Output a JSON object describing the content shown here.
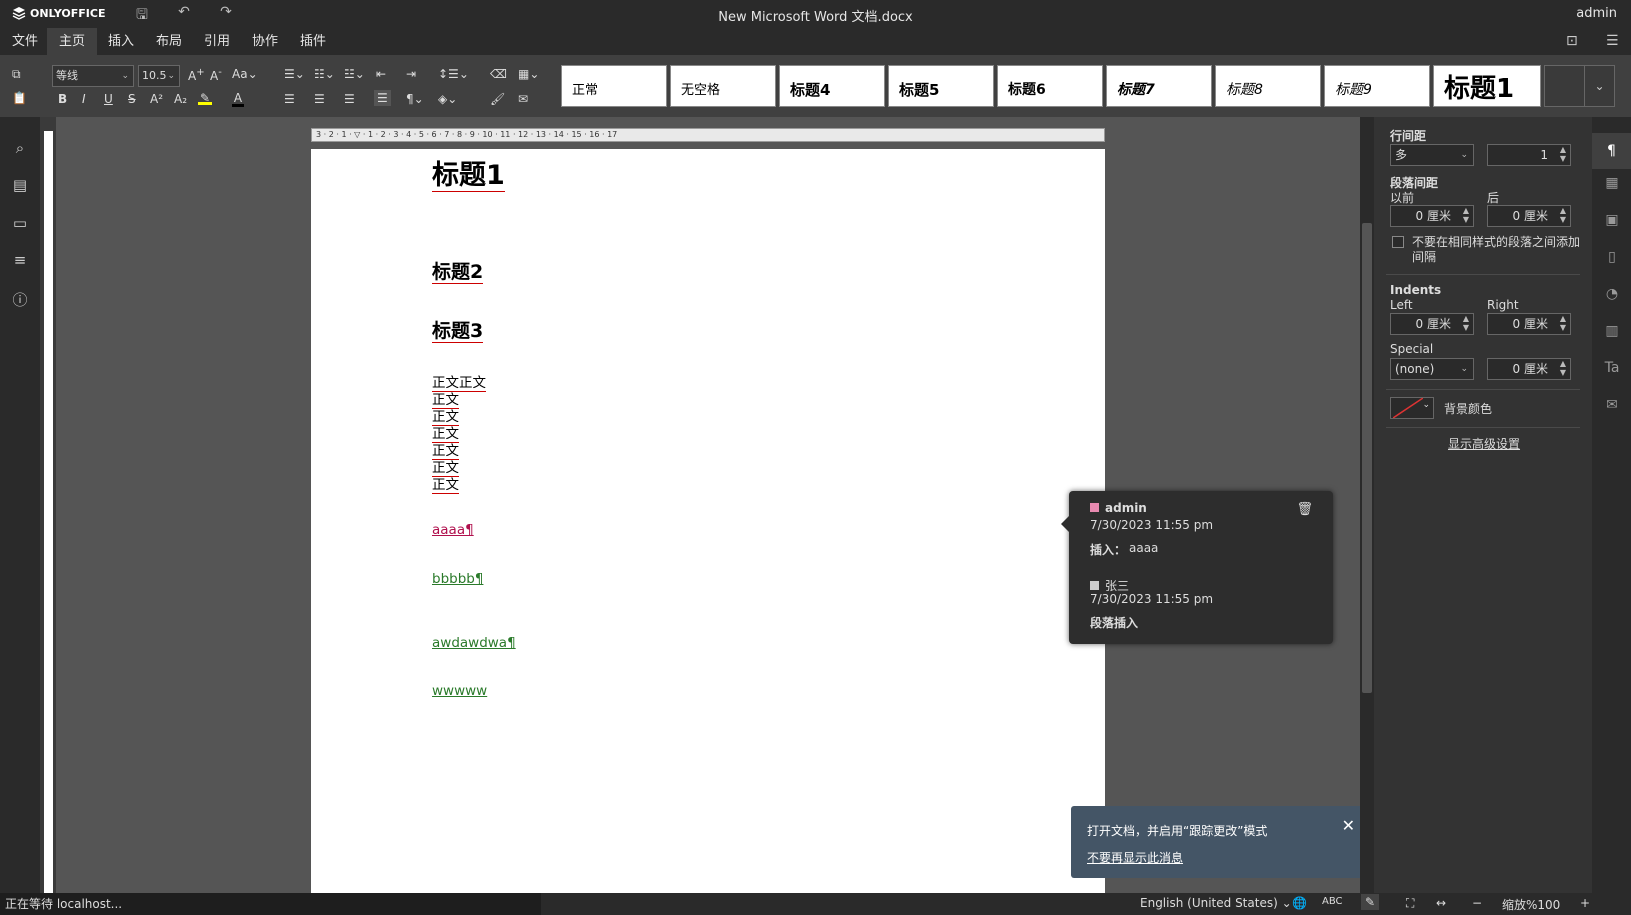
{
  "app": {
    "logo": "ONLYOFFICE",
    "doc_title": "New Microsoft Word 文档.docx",
    "user": "admin"
  },
  "menu": [
    "文件",
    "主页",
    "插入",
    "布局",
    "引用",
    "协作",
    "插件"
  ],
  "toolbar": {
    "font_name": "等线",
    "font_size": "10.5",
    "styles": [
      "正常",
      "无空格",
      "标题4",
      "标题5",
      "标题6",
      "标题7",
      "标题8",
      "标题9",
      "标题1"
    ]
  },
  "document": {
    "h1": "标题1",
    "h2": "标题2",
    "h3": "标题3",
    "body_lines": [
      "正文正文",
      "正文",
      "正文",
      "正文",
      "正文",
      "正文",
      "正文"
    ],
    "ins1": "aaaa¶",
    "ins2": "bbbbb¶",
    "ins3": "awdawdwa¶",
    "ins4": "wwwww"
  },
  "right_panel": {
    "line_spacing_label": "行间距",
    "line_spacing_type": "多",
    "line_spacing_value": "1",
    "para_spacing_label": "段落间距",
    "before_label": "以前",
    "after_label": "后",
    "before_value": "0 厘米",
    "after_value": "0 厘米",
    "no_space_checkbox": "不要在相同样式的段落之间添加间隔",
    "indents_label": "Indents",
    "left_label": "Left",
    "right_label": "Right",
    "left_value": "0 厘米",
    "right_value": "0 厘米",
    "special_label": "Special",
    "special_type": "(none)",
    "special_value": "0 厘米",
    "bg_color_label": "背景颜色",
    "advanced_link": "显示高级设置"
  },
  "comments": [
    {
      "author": "admin",
      "color": "#e88ab0",
      "date": "7/30/2023 11:55 pm",
      "label": "插入：",
      "text": "aaaa"
    },
    {
      "author": "张三",
      "color": "#cccccc",
      "date": "7/30/2023 11:55 pm",
      "text": "段落插入"
    }
  ],
  "notification": {
    "message": "打开文档，并启用“跟踪更改”模式",
    "link": "不要再显示此消息"
  },
  "status": {
    "loading": "正在等待 localhost...",
    "language": "English (United States)",
    "zoom": "缩放%100"
  }
}
